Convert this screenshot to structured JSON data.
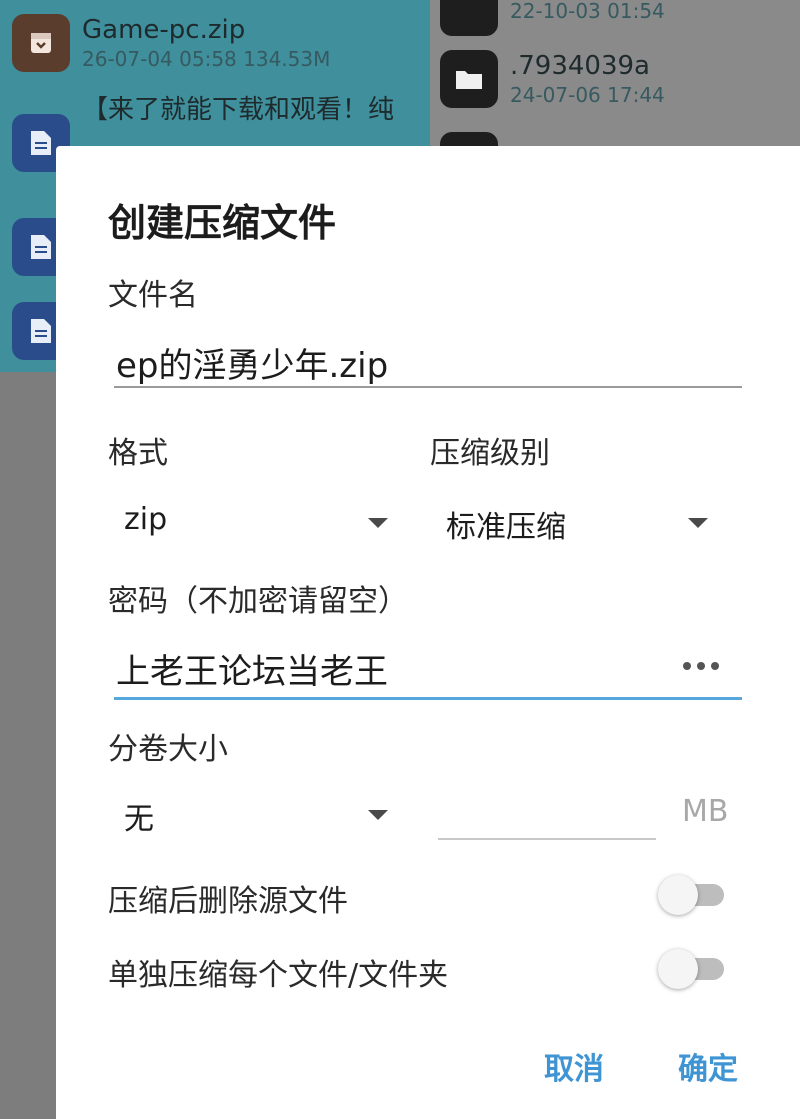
{
  "background": {
    "left_files": [
      {
        "name": "Game-pc.zip",
        "meta": "26-07-04 05:58  134.53M",
        "icon": "archive-icon"
      },
      {
        "name": "【来了就能下载和观看！纯",
        "meta": "",
        "icon": "document-icon"
      },
      {
        "name": "",
        "meta": "",
        "icon": "document-icon"
      },
      {
        "name": "",
        "meta": "",
        "icon": "document-icon"
      }
    ],
    "right_files": [
      {
        "name": "",
        "meta": "22-10-03 01:54",
        "icon": "folder-icon"
      },
      {
        "name": ".7934039a",
        "meta": "24-07-06 17:44",
        "icon": "folder-icon"
      },
      {
        "name": "",
        "meta": "",
        "icon": "folder-icon"
      }
    ]
  },
  "dialog": {
    "title": "创建压缩文件",
    "filename_label": "文件名",
    "filename_value": "ep的淫勇少年.zip",
    "format_label": "格式",
    "format_value": "zip",
    "level_label": "压缩级别",
    "level_value": "标准压缩",
    "password_label": "密码（不加密请留空）",
    "password_value": "上老王论坛当老王",
    "volume_label": "分卷大小",
    "volume_value": "无",
    "volume_unit": "MB",
    "delete_source_label": "压缩后删除源文件",
    "delete_source_on": false,
    "separate_label": "单独压缩每个文件/文件夹",
    "separate_on": false,
    "cancel_label": "取消",
    "confirm_label": "确定"
  },
  "colors": {
    "accent": "#3f95d3",
    "active_underline": "#55a7dd"
  }
}
